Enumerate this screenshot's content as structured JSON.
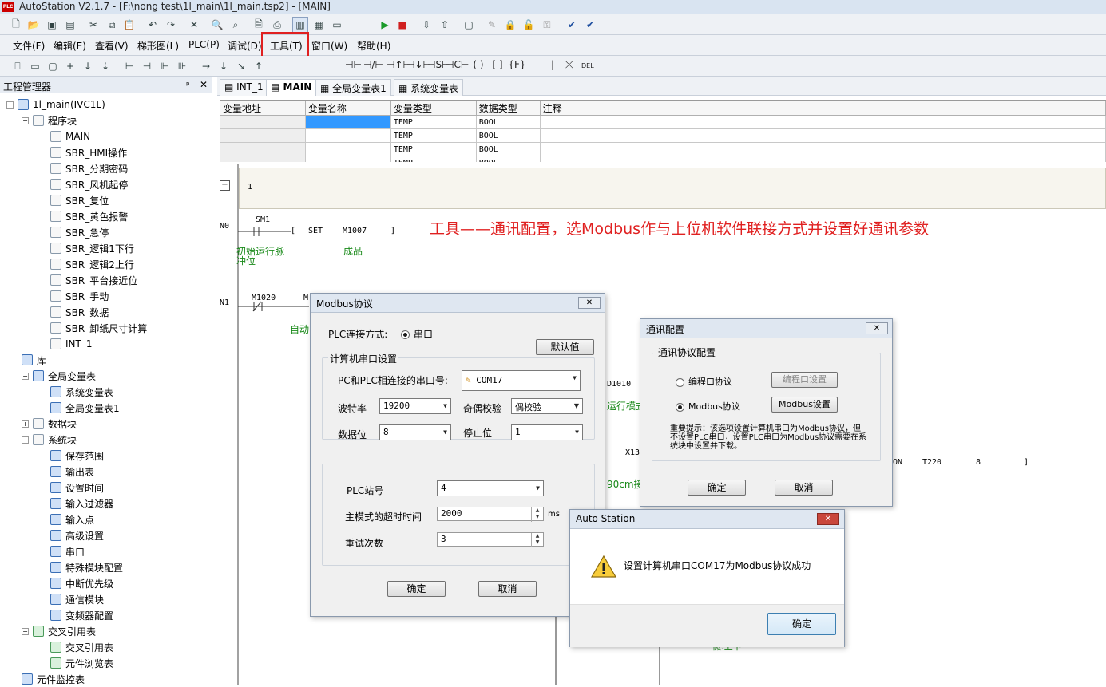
{
  "window": {
    "title": "AutoStation V2.1.7 - [F:\\nong test\\1l_main\\1l_main.tsp2] - [MAIN]",
    "logo": "PLC"
  },
  "menu": {
    "items": [
      "文件(F)",
      "编辑(E)",
      "查看(V)",
      "梯形图(L)",
      "PLC(P)",
      "调试(D)",
      "工具(T)",
      "窗口(W)",
      "帮助(H)"
    ]
  },
  "ladder_toolbar": {
    "items": [
      "⊣⊢",
      "⊣/⊢",
      "⊣↑⊢",
      "⊣↓⊢",
      "⊣S⊢",
      "⊣C⊢",
      "-( )",
      "-[ ]",
      "-{F}",
      "—",
      "|",
      "⤫",
      "DEL"
    ]
  },
  "project": {
    "title": "工程管理器",
    "pin": "ᵖ",
    "close": "✕",
    "tree": [
      {
        "label": "1l_main(IVC1L)",
        "depth": 0,
        "exp": "−",
        "icon": "blu"
      },
      {
        "label": "程序块",
        "depth": 1,
        "exp": "−",
        "icon": "file"
      },
      {
        "label": "MAIN",
        "depth": 2,
        "icon": "file"
      },
      {
        "label": "SBR_HMI操作",
        "depth": 2,
        "icon": "file"
      },
      {
        "label": "SBR_分期密码",
        "depth": 2,
        "icon": "file"
      },
      {
        "label": "SBR_风机起停",
        "depth": 2,
        "icon": "file"
      },
      {
        "label": "SBR_复位",
        "depth": 2,
        "icon": "file"
      },
      {
        "label": "SBR_黄色报警",
        "depth": 2,
        "icon": "file"
      },
      {
        "label": "SBR_急停",
        "depth": 2,
        "icon": "file"
      },
      {
        "label": "SBR_逻辑1下行",
        "depth": 2,
        "icon": "file"
      },
      {
        "label": "SBR_逻辑2上行",
        "depth": 2,
        "icon": "file"
      },
      {
        "label": "SBR_平台接近位",
        "depth": 2,
        "icon": "file"
      },
      {
        "label": "SBR_手动",
        "depth": 2,
        "icon": "file"
      },
      {
        "label": "SBR_数据",
        "depth": 2,
        "icon": "file"
      },
      {
        "label": "SBR_卸纸尺寸计算",
        "depth": 2,
        "icon": "file"
      },
      {
        "label": "INT_1",
        "depth": 2,
        "icon": "file"
      },
      {
        "label": "库",
        "depth": 1,
        "icon": "blu"
      },
      {
        "label": "全局变量表",
        "depth": 1,
        "exp": "−",
        "icon": "blu"
      },
      {
        "label": "系统变量表",
        "depth": 2,
        "icon": "blu"
      },
      {
        "label": "全局变量表1",
        "depth": 2,
        "icon": "blu"
      },
      {
        "label": "数据块",
        "depth": 1,
        "exp": "+",
        "icon": "file"
      },
      {
        "label": "系统块",
        "depth": 1,
        "exp": "−",
        "icon": "file"
      },
      {
        "label": "保存范围",
        "depth": 2,
        "icon": "blu"
      },
      {
        "label": "输出表",
        "depth": 2,
        "icon": "blu"
      },
      {
        "label": "设置时间",
        "depth": 2,
        "icon": "blu"
      },
      {
        "label": "输入过滤器",
        "depth": 2,
        "icon": "blu"
      },
      {
        "label": "输入点",
        "depth": 2,
        "icon": "blu"
      },
      {
        "label": "高级设置",
        "depth": 2,
        "icon": "blu"
      },
      {
        "label": "串口",
        "depth": 2,
        "icon": "blu"
      },
      {
        "label": "特殊模块配置",
        "depth": 2,
        "icon": "blu"
      },
      {
        "label": "中断优先级",
        "depth": 2,
        "icon": "blu"
      },
      {
        "label": "通信模块",
        "depth": 2,
        "icon": "blu"
      },
      {
        "label": "变频器配置",
        "depth": 2,
        "icon": "blu"
      },
      {
        "label": "交叉引用表",
        "depth": 1,
        "exp": "−",
        "icon": "grn"
      },
      {
        "label": "交叉引用表",
        "depth": 2,
        "icon": "grn"
      },
      {
        "label": "元件浏览表",
        "depth": 2,
        "icon": "grn"
      },
      {
        "label": "元件监控表",
        "depth": 1,
        "icon": "blu"
      }
    ]
  },
  "tabs": [
    "INT_1",
    "MAIN",
    "全局变量表1",
    "系统变量表"
  ],
  "var_table": {
    "headers": [
      "变量地址",
      "变量名称",
      "变量类型",
      "数据类型",
      "注释"
    ],
    "rows": [
      [
        "",
        "",
        "TEMP",
        "BOOL",
        ""
      ],
      [
        "",
        "",
        "TEMP",
        "BOOL",
        ""
      ],
      [
        "",
        "",
        "TEMP",
        "BOOL",
        ""
      ],
      [
        "",
        "",
        "TEMP",
        "BOOL",
        ""
      ]
    ]
  },
  "ladder": {
    "net1_num": "1",
    "collapse": "−",
    "n0": "N0",
    "n1": "N1",
    "sm1": "SM1",
    "set": "SET",
    "m1007": "M1007",
    "bracket": "]",
    "c_sm1": "初始运行脉",
    "c_sm1b": "冲位",
    "c_m1007": "成品",
    "m1020": "M1020",
    "m_frag": "M",
    "auto": "自动",
    "d1010": "D1010",
    "run": "运行模式",
    "x13": "X13",
    "on": "ON",
    "t220": "T220",
    "eight": "8",
    "close": "]",
    "c90": "90cm接近",
    "bottom_frag": "微:上下"
  },
  "caption": "工具——通讯配置，选Modbus作与上位机软件联接方式并设置好通讯参数",
  "modbus": {
    "title": "Modbus协议",
    "close": "✕",
    "conn_label": "PLC连接方式:",
    "conn_value": "串口",
    "default_btn": "默认值",
    "grp_title": "计算机串口设置",
    "port_label": "PC和PLC相连接的串口号:",
    "port": "COM17",
    "baud_label": "波特率",
    "baud": "19200",
    "parity_label": "奇偶校验",
    "parity": "偶校验",
    "data_label": "数据位",
    "data": "8",
    "stop_label": "停止位",
    "stop": "1",
    "station_label": "PLC站号",
    "station": "4",
    "timeout_label": "主模式的超时时间",
    "timeout": "2000",
    "ms": "ms",
    "retry_label": "重试次数",
    "retry": "3",
    "ok": "确定",
    "cancel": "取消"
  },
  "comm": {
    "title": "通讯配置",
    "close": "✕",
    "grp": "通讯协议配置",
    "opt1": "编程口协议",
    "btn1": "编程口设置",
    "opt2": "Modbus协议",
    "btn2": "Modbus设置",
    "note": "重要提示：该选项设置计算机串口为Modbus协议，但不设置PLC串口，设置PLC串口为Modbus协议需要在系统块中设置并下载。",
    "ok": "确定",
    "cancel": "取消"
  },
  "alert": {
    "title": "Auto Station",
    "close": "✕",
    "msg": "设置计算机串口COM17为Modbus协议成功",
    "ok": "确定"
  }
}
